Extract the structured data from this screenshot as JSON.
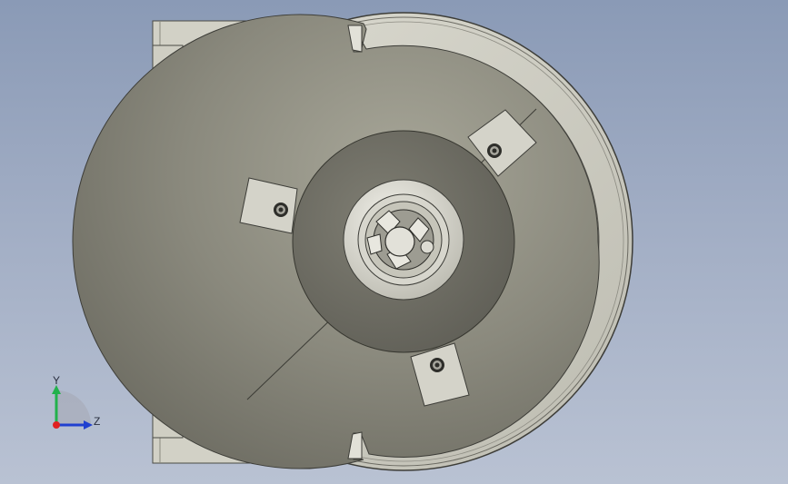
{
  "view": {
    "background_top": "#8a9ab6",
    "background_bottom": "#b9c2d3"
  },
  "model": {
    "body_color": "#d2d1c6",
    "disc_color": "#8d8c80",
    "hub_color": "#e6e4dc"
  },
  "triad": {
    "y_label": "Y",
    "z_label": "Z",
    "y_color": "#22b14c",
    "z_color": "#2040d0",
    "x_color": "#e02020"
  }
}
